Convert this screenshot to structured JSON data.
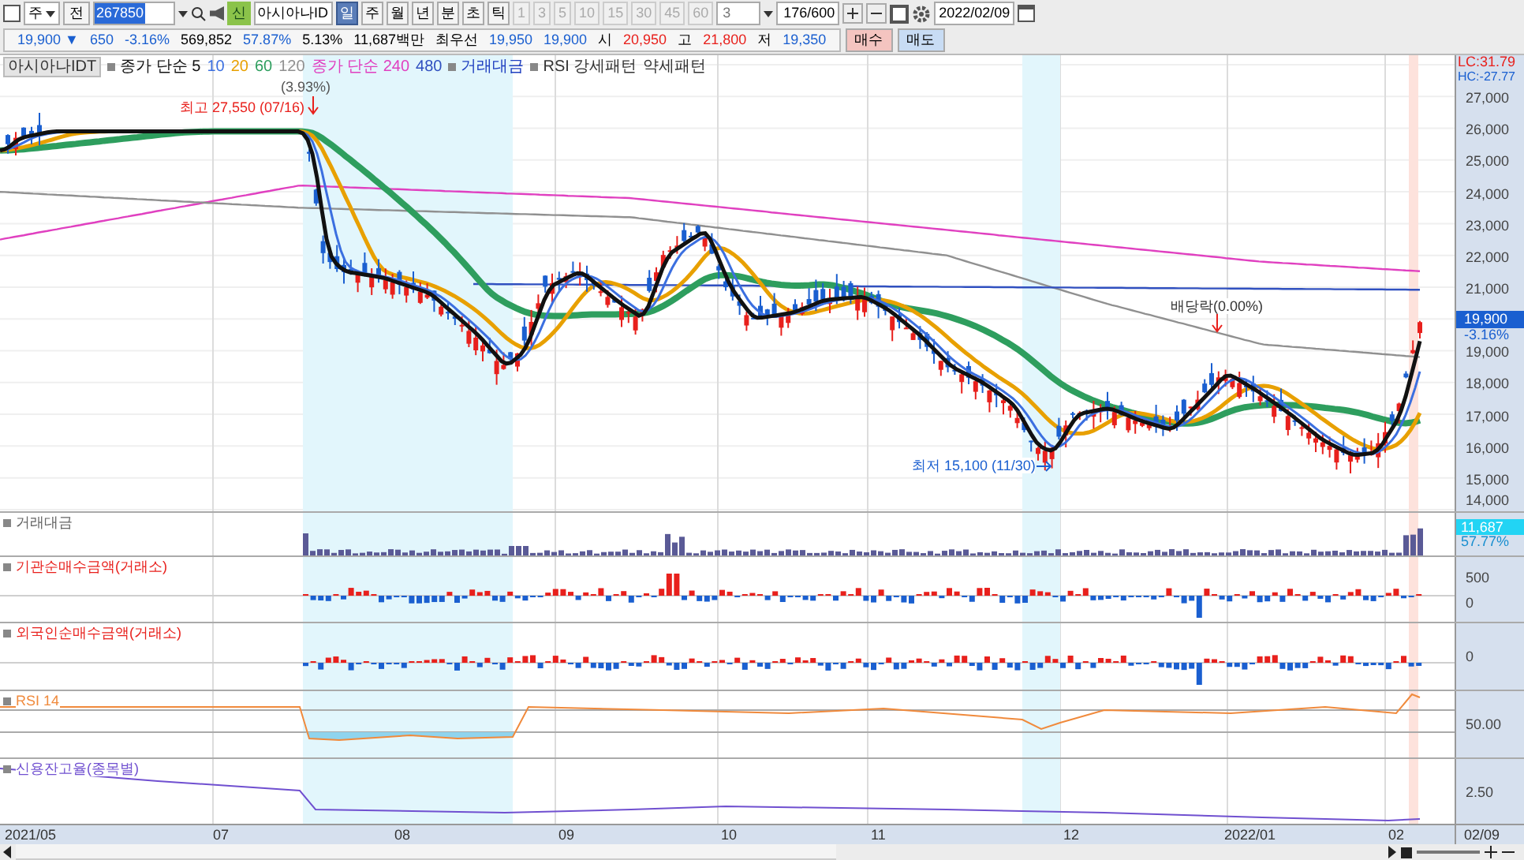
{
  "toolbar": {
    "market": "주",
    "scope": "전",
    "code": "267850",
    "badge": "신",
    "name": "아시아나ID",
    "periods": [
      {
        "label": "일",
        "selected": true
      },
      {
        "label": "주",
        "selected": false
      },
      {
        "label": "월",
        "selected": false
      },
      {
        "label": "년",
        "selected": false
      },
      {
        "label": "분",
        "selected": false
      },
      {
        "label": "초",
        "selected": false
      },
      {
        "label": "틱",
        "selected": false
      }
    ],
    "intervals": [
      {
        "label": "1",
        "disabled": true
      },
      {
        "label": "3",
        "disabled": true
      },
      {
        "label": "5",
        "disabled": true
      },
      {
        "label": "10",
        "disabled": true
      },
      {
        "label": "15",
        "disabled": true
      },
      {
        "label": "30",
        "disabled": true
      },
      {
        "label": "45",
        "disabled": true
      },
      {
        "label": "60",
        "disabled": true
      }
    ],
    "interval_value": "3",
    "count": "176/600",
    "date": "2022/02/09"
  },
  "quote": {
    "price": "19,900 ▼",
    "change": "650",
    "change_rate": "-3.16%",
    "volume": "569,852",
    "volume_ratio": "57.87%",
    "turnover": "5.13%",
    "amount": "11,687백만",
    "best_label": "최우선",
    "ask": "19,950",
    "bid": "19,900",
    "open_label": "시",
    "open": "20,950",
    "high_label": "고",
    "high": "21,800",
    "low_label": "저",
    "low": "19,350",
    "buttons": [
      {
        "label": "매수",
        "kind": "buy"
      },
      {
        "label": "매도",
        "kind": "sell"
      }
    ]
  },
  "legend": [
    {
      "label": "아시아나IDT",
      "kind": "title",
      "color": "#333333"
    },
    {
      "label": "종가 단순 5",
      "kind": "group",
      "color": "#111111"
    },
    {
      "label": "10",
      "kind": "plain",
      "color": "#3b6fe0"
    },
    {
      "label": "20",
      "kind": "plain",
      "color": "#e8a000"
    },
    {
      "label": "60",
      "kind": "plain",
      "color": "#2e9e5e"
    },
    {
      "label": "120",
      "kind": "plain",
      "color": "#909090"
    },
    {
      "label": "종가 단순 240",
      "kind": "plain",
      "color": "#e040c0"
    },
    {
      "label": "480",
      "kind": "plain",
      "color": "#3050c0"
    },
    {
      "label": "거래대금",
      "kind": "group",
      "color": "#2040c0"
    },
    {
      "label": "RSI 강세패턴",
      "kind": "group",
      "color": "#333333"
    },
    {
      "label": "약세패턴",
      "kind": "plain",
      "color": "#333333"
    }
  ],
  "annotations": [
    {
      "text": "(3.93%)",
      "kind": "note"
    },
    {
      "text": "최고 27,550 (07/16)",
      "kind": "high"
    },
    {
      "text": "배당락(0.00%)",
      "kind": "dividend"
    },
    {
      "text": "최저 15,100 (11/30)",
      "kind": "low"
    }
  ],
  "price_axis": {
    "lc": "LC:31.79",
    "hc": "HC:-27.77",
    "ticks": [
      "27,000",
      "26,000",
      "25,000",
      "24,000",
      "23,000",
      "22,000",
      "21,000",
      "19,000",
      "18,000",
      "17,000",
      "16,000",
      "15,000",
      "14,000"
    ],
    "current": "19,900",
    "current_change": "-3.16%"
  },
  "panels": [
    {
      "title": "거래대금",
      "kind": "volume",
      "tag": "11,687",
      "tag_sub": "57.77%"
    },
    {
      "title": "기관순매수금액(거래소)",
      "kind": "bars",
      "ticks": [
        "500",
        "0"
      ]
    },
    {
      "title": "외국인순매수금액(거래소)",
      "kind": "bars",
      "ticks": [
        "0"
      ]
    },
    {
      "title": "RSI 14",
      "kind": "rsi",
      "ticks": [
        "50.00"
      ]
    },
    {
      "title": "신용잔고율(종목별)",
      "kind": "line",
      "ticks": [
        "2.50"
      ]
    }
  ],
  "x_axis": [
    "2021/05",
    "07",
    "08",
    "09",
    "10",
    "11",
    "12",
    "2022/01",
    "02"
  ],
  "x_axis_end": "02/09"
}
